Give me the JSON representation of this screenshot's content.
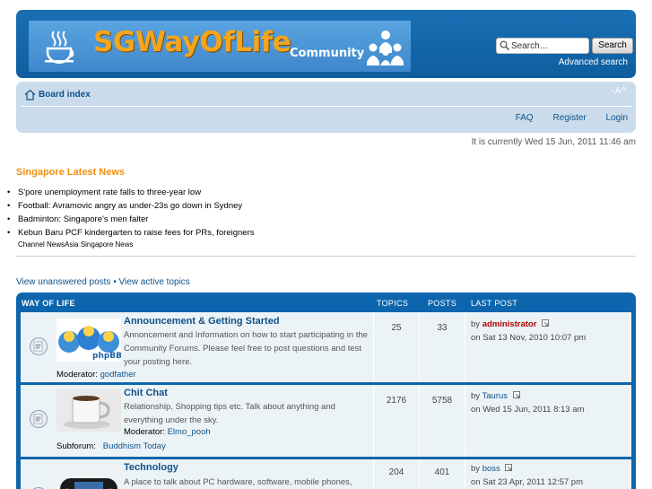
{
  "header": {
    "brand": "SGWayOfLife",
    "subtitle": "Community",
    "search_placeholder": "Search…",
    "search_button": "Search",
    "advanced_search": "Advanced search"
  },
  "navbar": {
    "board_index": "Board index",
    "font_size": "-A^",
    "links": [
      "FAQ",
      "Register",
      "Login"
    ]
  },
  "current_time": "It is currently Wed 15 Jun, 2011 11:46 am",
  "news": {
    "title": "Singapore Latest News",
    "items": [
      "S'pore unemployment rate falls to three-year low",
      "Football: Avramovic angry as under-23s go down in Sydney",
      "Badminton: Singapore's men falter",
      "Kebun Baru PCF kindergarten to raise fees for PRs, foreigners"
    ],
    "source": "Channel NewsAsia Singapore News"
  },
  "top_links": {
    "unanswered": "View unanswered posts",
    "separator": " • ",
    "active": "View active topics"
  },
  "forum": {
    "category": "WAY OF LIFE",
    "col_topics": "TOPICS",
    "col_posts": "POSTS",
    "col_last_post": "LAST POST",
    "rows": [
      {
        "title": "Announcement & Getting Started",
        "description": "Annoncement and Information on how to start participating in the Community Forums. Please feel free to post questions and test your posting here.",
        "moderator_label": "Moderator:",
        "moderator": "godfather",
        "topics": "25",
        "posts": "33",
        "last_by_label": "by",
        "last_by": "administrator",
        "last_on": "on Sat 13 Nov, 2010 10:07 pm"
      },
      {
        "title": "Chit Chat",
        "description": "Relationship, Shopping tips etc. Talk about anything and everything under the sky.",
        "moderator_label": "Moderator:",
        "moderator": "Elmo_pooh",
        "subforum_label": "Subforum:",
        "subforum": "Buddhism Today",
        "topics": "2176",
        "posts": "5758",
        "last_by_label": "by",
        "last_by": "Taurus",
        "last_on": "on Wed 15 Jun, 2011 8:13 am"
      },
      {
        "title": "Technology",
        "description": "A place to talk about PC hardware, software, mobile phones,",
        "topics": "204",
        "posts": "401",
        "last_by_label": "by",
        "last_by": "boss",
        "last_on": "on Sat 23 Apr, 2011 12:57 pm"
      }
    ]
  }
}
